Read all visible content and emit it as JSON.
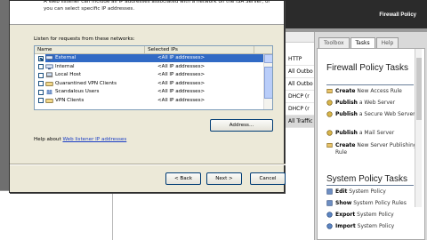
{
  "wizard": {
    "description": "A Web listener can include all IP addresses associated with a network on the ISA Server, or you can select specific IP addresses.",
    "list_label": "Listen for requests from these networks:",
    "columns": [
      "Name",
      "Selected IPs"
    ],
    "networks": [
      {
        "name": "External",
        "ips": "<All IP addresses>",
        "checked": true,
        "selected": true,
        "icon": "network-icon"
      },
      {
        "name": "Internal",
        "ips": "<All IP addresses>",
        "checked": false,
        "selected": false,
        "icon": "network-icon"
      },
      {
        "name": "Local Host",
        "ips": "<All IP addresses>",
        "checked": false,
        "selected": false,
        "icon": "computer-icon"
      },
      {
        "name": "Quarantined VPN Clients",
        "ips": "<All IP addresses>",
        "checked": false,
        "selected": false,
        "icon": "vpn-icon"
      },
      {
        "name": "Scandalous Users",
        "ips": "<All IP addresses>",
        "checked": false,
        "selected": false,
        "icon": "users-icon"
      },
      {
        "name": "VPN Clients",
        "ips": "<All IP addresses>",
        "checked": false,
        "selected": false,
        "icon": "vpn-icon"
      }
    ],
    "address_button": "Address...",
    "help_prefix": "Help about",
    "help_link": "Web listener IP addresses",
    "back_button": "< Back",
    "next_button": "Next >",
    "cancel_button": "Cancel"
  },
  "console": {
    "header_title": "Firewall Policy",
    "rules_column": [
      "HTTP",
      "All Outbo",
      "All Outbo",
      "DHCP (r",
      "DHCP (r",
      "All Traffic"
    ],
    "tabs": [
      "Toolbox",
      "Tasks",
      "Help"
    ],
    "active_tab": "Tasks",
    "firewall_section_title": "Firewall Policy Tasks",
    "firewall_tasks": [
      {
        "bold": "Create",
        "rest": "New Access Rule",
        "icon": "rule-icon"
      },
      {
        "bold": "Publish",
        "rest": "a Web Server",
        "icon": "server-icon"
      },
      {
        "bold": "Publish",
        "rest": "a Secure Web Server",
        "icon": "server-icon"
      },
      {
        "bold": "Publish",
        "rest": "a Mail Server",
        "icon": "server-icon"
      },
      {
        "bold": "Create",
        "rest": "New Server Publishing Rule",
        "icon": "rule-icon"
      }
    ],
    "system_section_title": "System Policy Tasks",
    "system_tasks": [
      {
        "bold": "Edit",
        "rest": "System Policy",
        "icon": "edit-icon"
      },
      {
        "bold": "Show",
        "rest": "System Policy Rules",
        "icon": "show-icon"
      },
      {
        "bold": "Export",
        "rest": "System Policy",
        "icon": "export-icon"
      },
      {
        "bold": "Import",
        "rest": "System Policy",
        "icon": "import-icon"
      }
    ]
  },
  "colors": {
    "selection": "#316ac5",
    "link": "#1a3ec5",
    "header_dark": "#2b2b2b",
    "dialog_face": "#ece9d8"
  }
}
